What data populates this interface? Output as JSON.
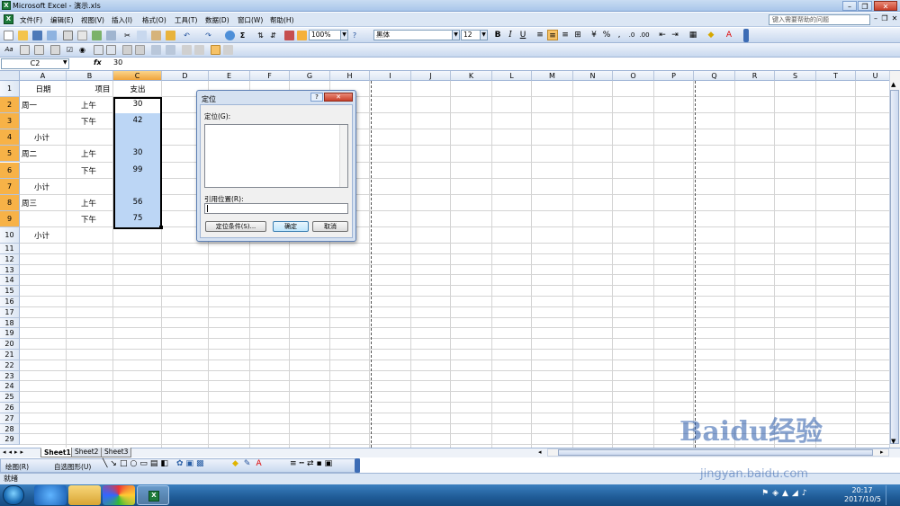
{
  "window": {
    "title": "Microsoft Excel - 演示.xls",
    "app_icon": "excel-icon"
  },
  "menu": [
    "文件(F)",
    "编辑(E)",
    "视图(V)",
    "插入(I)",
    "格式(O)",
    "工具(T)",
    "数据(D)",
    "窗口(W)",
    "帮助(H)"
  ],
  "help_box": {
    "placeholder": "键入需要帮助的问题"
  },
  "toolbar": {
    "zoom": "100%",
    "font": "黑体",
    "font_size": "12"
  },
  "formula_bar": {
    "name_box": "C2",
    "fx": "fx",
    "value": "30"
  },
  "columns": [
    "A",
    "B",
    "C",
    "D",
    "E",
    "F",
    "G",
    "H",
    "I",
    "J",
    "K",
    "L",
    "M",
    "N",
    "O",
    "P",
    "Q",
    "R",
    "S",
    "T",
    "U"
  ],
  "rows": [
    "1",
    "2",
    "3",
    "4",
    "5",
    "6",
    "7",
    "8",
    "9",
    "10",
    "11",
    "12",
    "13",
    "14",
    "15",
    "16",
    "17",
    "18",
    "19",
    "20",
    "21",
    "22",
    "23",
    "24",
    "25",
    "26",
    "27",
    "28",
    "29"
  ],
  "cells": {
    "A1": "日期",
    "B1": "项目",
    "C1": "支出",
    "A2": "周一",
    "B2": "上午",
    "C2": "30",
    "B3": "下午",
    "C3": "42",
    "A4": "小计",
    "A5": "周二",
    "B5": "上午",
    "C5": "30",
    "B6": "下午",
    "C6": "99",
    "A7": "小计",
    "A8": "周三",
    "B8": "上午",
    "C8": "56",
    "B9": "下午",
    "C9": "75",
    "A10": "小计"
  },
  "sheets": [
    "Sheet1",
    "Sheet2",
    "Sheet3"
  ],
  "dialog": {
    "title": "定位",
    "list_label": "定位(G):",
    "ref_label": "引用位置(R):",
    "ref_value": "",
    "special_button": "定位条件(S)...",
    "ok_button": "确定",
    "cancel_button": "取消"
  },
  "draw_toolbar": {
    "draw_label": "绘图(R)",
    "autoshape_label": "自选图形(U)"
  },
  "status": "就绪",
  "clock": {
    "time": "20:17",
    "date": "2017/10/5"
  },
  "watermark": {
    "logo": "Baidu经验",
    "url": "jingyan.baidu.com"
  }
}
